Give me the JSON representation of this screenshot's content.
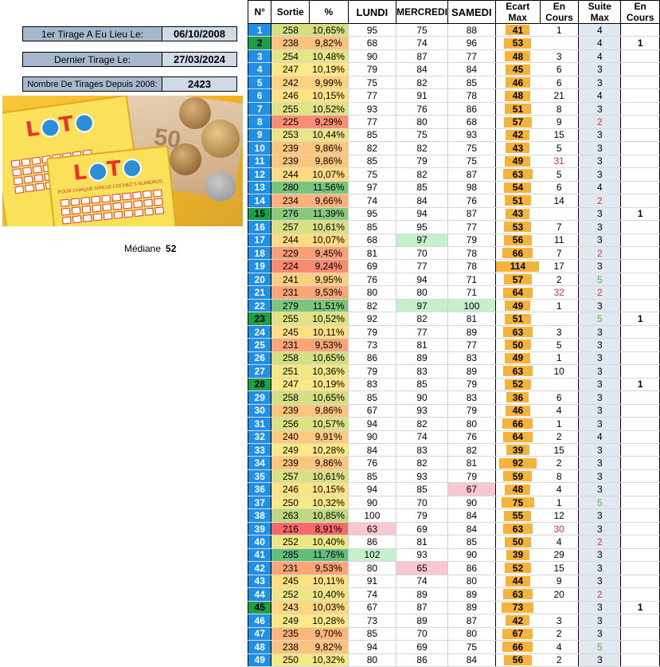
{
  "info": {
    "first_label": "1er Tirage A Eu Lieu Le:",
    "first_value": "06/10/2008",
    "last_label": "Dernier Tirage Le:",
    "last_value": "27/03/2024",
    "count_label": "Nombre De Tirages Depuis 2008:",
    "count_value": "2423"
  },
  "median": {
    "label": "Médiane",
    "value": "52"
  },
  "photo": {
    "brand_text": "LOTO",
    "grid_text": "POUR CHAQUE GRILLE COCHEZ 5 NUMEROS",
    "note_value": "50"
  },
  "colors": {
    "number_blue": "#1e90e8",
    "number_green": "#1f9e49",
    "bar_orange": "#f5b33a",
    "red_text": "#e03030",
    "green_text": "#58b040"
  },
  "columns": [
    "N°",
    "Sortie",
    "%",
    "LUNDI",
    "MERCREDI",
    "SAMEDI",
    "Ecart Max",
    "En Cours",
    "Suite Max",
    "En Cours"
  ],
  "rows": [
    [
      "1",
      "258",
      "10,65%",
      "95",
      "75",
      "88",
      "41",
      "1",
      "4",
      ""
    ],
    [
      "2",
      "238",
      "9,82%",
      "68",
      "74",
      "96",
      "53",
      "",
      "4",
      "1"
    ],
    [
      "3",
      "254",
      "10,48%",
      "90",
      "87",
      "77",
      "48",
      "3",
      "4",
      ""
    ],
    [
      "4",
      "247",
      "10,19%",
      "79",
      "84",
      "84",
      "45",
      "6",
      "3",
      ""
    ],
    [
      "5",
      "242",
      "9,99%",
      "75",
      "82",
      "85",
      "46",
      "6",
      "3",
      ""
    ],
    [
      "6",
      "246",
      "10,15%",
      "77",
      "91",
      "78",
      "48",
      "21",
      "4",
      ""
    ],
    [
      "7",
      "255",
      "10,52%",
      "93",
      "76",
      "86",
      "51",
      "8",
      "3",
      ""
    ],
    [
      "8",
      "225",
      "9,29%",
      "77",
      "80",
      "68",
      "57",
      "9",
      "2",
      ""
    ],
    [
      "9",
      "253",
      "10,44%",
      "85",
      "75",
      "93",
      "42",
      "15",
      "3",
      ""
    ],
    [
      "10",
      "239",
      "9,86%",
      "82",
      "82",
      "75",
      "43",
      "5",
      "3",
      ""
    ],
    [
      "11",
      "239",
      "9,86%",
      "85",
      "79",
      "75",
      "49",
      "31",
      "3",
      ""
    ],
    [
      "12",
      "244",
      "10,07%",
      "75",
      "82",
      "87",
      "63",
      "5",
      "3",
      ""
    ],
    [
      "13",
      "280",
      "11,56%",
      "97",
      "85",
      "98",
      "54",
      "6",
      "4",
      ""
    ],
    [
      "14",
      "234",
      "9,66%",
      "74",
      "84",
      "76",
      "51",
      "14",
      "2",
      ""
    ],
    [
      "15",
      "276",
      "11,39%",
      "95",
      "94",
      "87",
      "43",
      "",
      "3",
      "1"
    ],
    [
      "16",
      "257",
      "10,61%",
      "85",
      "95",
      "77",
      "53",
      "7",
      "3",
      ""
    ],
    [
      "17",
      "244",
      "10,07%",
      "68",
      "97",
      "79",
      "56",
      "11",
      "3",
      ""
    ],
    [
      "18",
      "229",
      "9,45%",
      "81",
      "70",
      "78",
      "66",
      "7",
      "2",
      ""
    ],
    [
      "19",
      "224",
      "9,24%",
      "69",
      "77",
      "78",
      "114",
      "17",
      "3",
      ""
    ],
    [
      "20",
      "241",
      "9,95%",
      "76",
      "94",
      "71",
      "57",
      "2",
      "5",
      ""
    ],
    [
      "21",
      "231",
      "9,53%",
      "80",
      "80",
      "71",
      "64",
      "32",
      "2",
      ""
    ],
    [
      "22",
      "279",
      "11,51%",
      "82",
      "97",
      "100",
      "49",
      "1",
      "3",
      ""
    ],
    [
      "23",
      "255",
      "10,52%",
      "92",
      "82",
      "81",
      "51",
      "",
      "5",
      "1"
    ],
    [
      "24",
      "245",
      "10,11%",
      "79",
      "77",
      "89",
      "63",
      "3",
      "3",
      ""
    ],
    [
      "25",
      "231",
      "9,53%",
      "73",
      "81",
      "77",
      "50",
      "5",
      "3",
      ""
    ],
    [
      "26",
      "258",
      "10,65%",
      "86",
      "89",
      "83",
      "49",
      "1",
      "3",
      ""
    ],
    [
      "27",
      "251",
      "10,36%",
      "79",
      "83",
      "89",
      "63",
      "10",
      "3",
      ""
    ],
    [
      "28",
      "247",
      "10,19%",
      "83",
      "85",
      "79",
      "52",
      "",
      "3",
      "1"
    ],
    [
      "29",
      "258",
      "10,65%",
      "85",
      "90",
      "83",
      "36",
      "6",
      "3",
      ""
    ],
    [
      "30",
      "239",
      "9,86%",
      "67",
      "93",
      "79",
      "46",
      "4",
      "3",
      ""
    ],
    [
      "31",
      "256",
      "10,57%",
      "94",
      "82",
      "80",
      "66",
      "1",
      "3",
      ""
    ],
    [
      "32",
      "240",
      "9,91%",
      "90",
      "74",
      "76",
      "64",
      "2",
      "4",
      ""
    ],
    [
      "33",
      "249",
      "10,28%",
      "84",
      "83",
      "82",
      "39",
      "15",
      "3",
      ""
    ],
    [
      "34",
      "239",
      "9,86%",
      "76",
      "82",
      "81",
      "92",
      "2",
      "3",
      ""
    ],
    [
      "35",
      "257",
      "10,61%",
      "85",
      "93",
      "79",
      "59",
      "8",
      "3",
      ""
    ],
    [
      "36",
      "246",
      "10,15%",
      "94",
      "85",
      "67",
      "48",
      "4",
      "3",
      ""
    ],
    [
      "37",
      "250",
      "10,32%",
      "90",
      "70",
      "90",
      "75",
      "1",
      "5",
      ""
    ],
    [
      "38",
      "263",
      "10,85%",
      "100",
      "79",
      "84",
      "55",
      "12",
      "3",
      ""
    ],
    [
      "39",
      "216",
      "8,91%",
      "63",
      "69",
      "84",
      "63",
      "30",
      "3",
      ""
    ],
    [
      "40",
      "252",
      "10,40%",
      "86",
      "81",
      "85",
      "50",
      "4",
      "2",
      ""
    ],
    [
      "41",
      "285",
      "11,76%",
      "102",
      "93",
      "90",
      "39",
      "29",
      "3",
      ""
    ],
    [
      "42",
      "231",
      "9,53%",
      "80",
      "65",
      "86",
      "52",
      "15",
      "3",
      ""
    ],
    [
      "43",
      "245",
      "10,11%",
      "91",
      "74",
      "80",
      "44",
      "9",
      "3",
      ""
    ],
    [
      "44",
      "252",
      "10,40%",
      "74",
      "89",
      "89",
      "63",
      "20",
      "2",
      ""
    ],
    [
      "45",
      "243",
      "10,03%",
      "67",
      "87",
      "89",
      "73",
      "",
      "3",
      "1"
    ],
    [
      "46",
      "249",
      "10,28%",
      "73",
      "89",
      "87",
      "42",
      "3",
      "3",
      ""
    ],
    [
      "47",
      "235",
      "9,70%",
      "85",
      "70",
      "80",
      "67",
      "2",
      "3",
      ""
    ],
    [
      "48",
      "238",
      "9,82%",
      "94",
      "69",
      "75",
      "66",
      "4",
      "5",
      ""
    ],
    [
      "49",
      "250",
      "10,32%",
      "80",
      "86",
      "84",
      "56",
      "2",
      "3",
      ""
    ]
  ]
}
